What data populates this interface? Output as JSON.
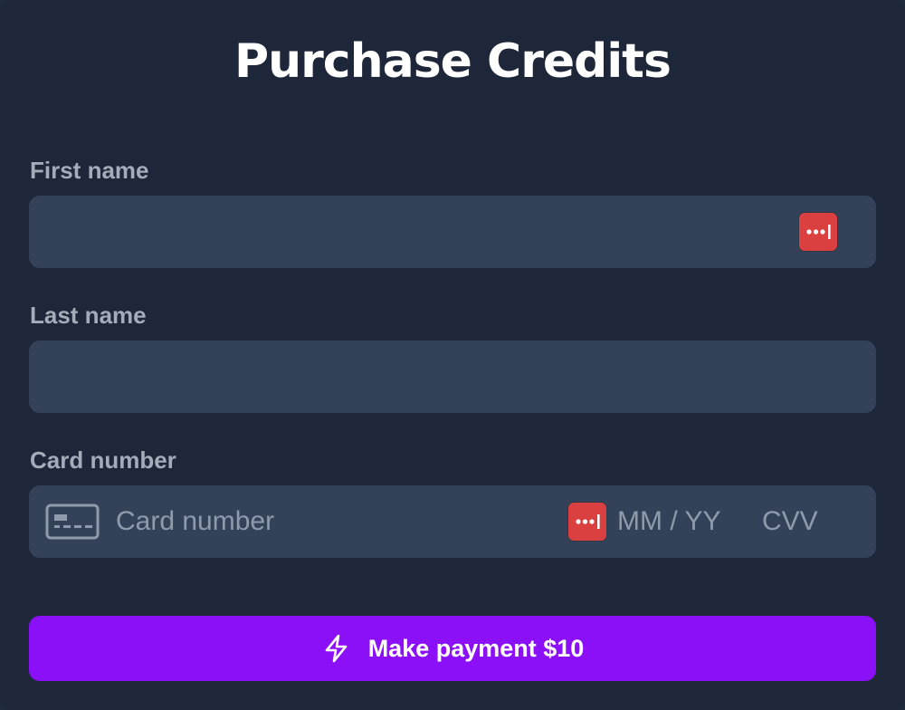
{
  "form": {
    "title": "Purchase Credits",
    "first_name": {
      "label": "First name",
      "value": "",
      "placeholder": ""
    },
    "last_name": {
      "label": "Last name",
      "value": "",
      "placeholder": ""
    },
    "card": {
      "label": "Card number",
      "number_placeholder": "Card number",
      "expiry_placeholder": "MM / YY",
      "cvv_placeholder": "CVV"
    },
    "submit": {
      "label": "Make payment $10",
      "icon": "lightning-bolt-icon"
    }
  },
  "icons": {
    "password_manager": "password-manager-icon",
    "card": "credit-card-icon"
  },
  "colors": {
    "background": "#1e2739",
    "field_background": "#334259",
    "label": "#a3acb9",
    "accent": "#8b10f7",
    "password_manager": "#d9403f"
  }
}
